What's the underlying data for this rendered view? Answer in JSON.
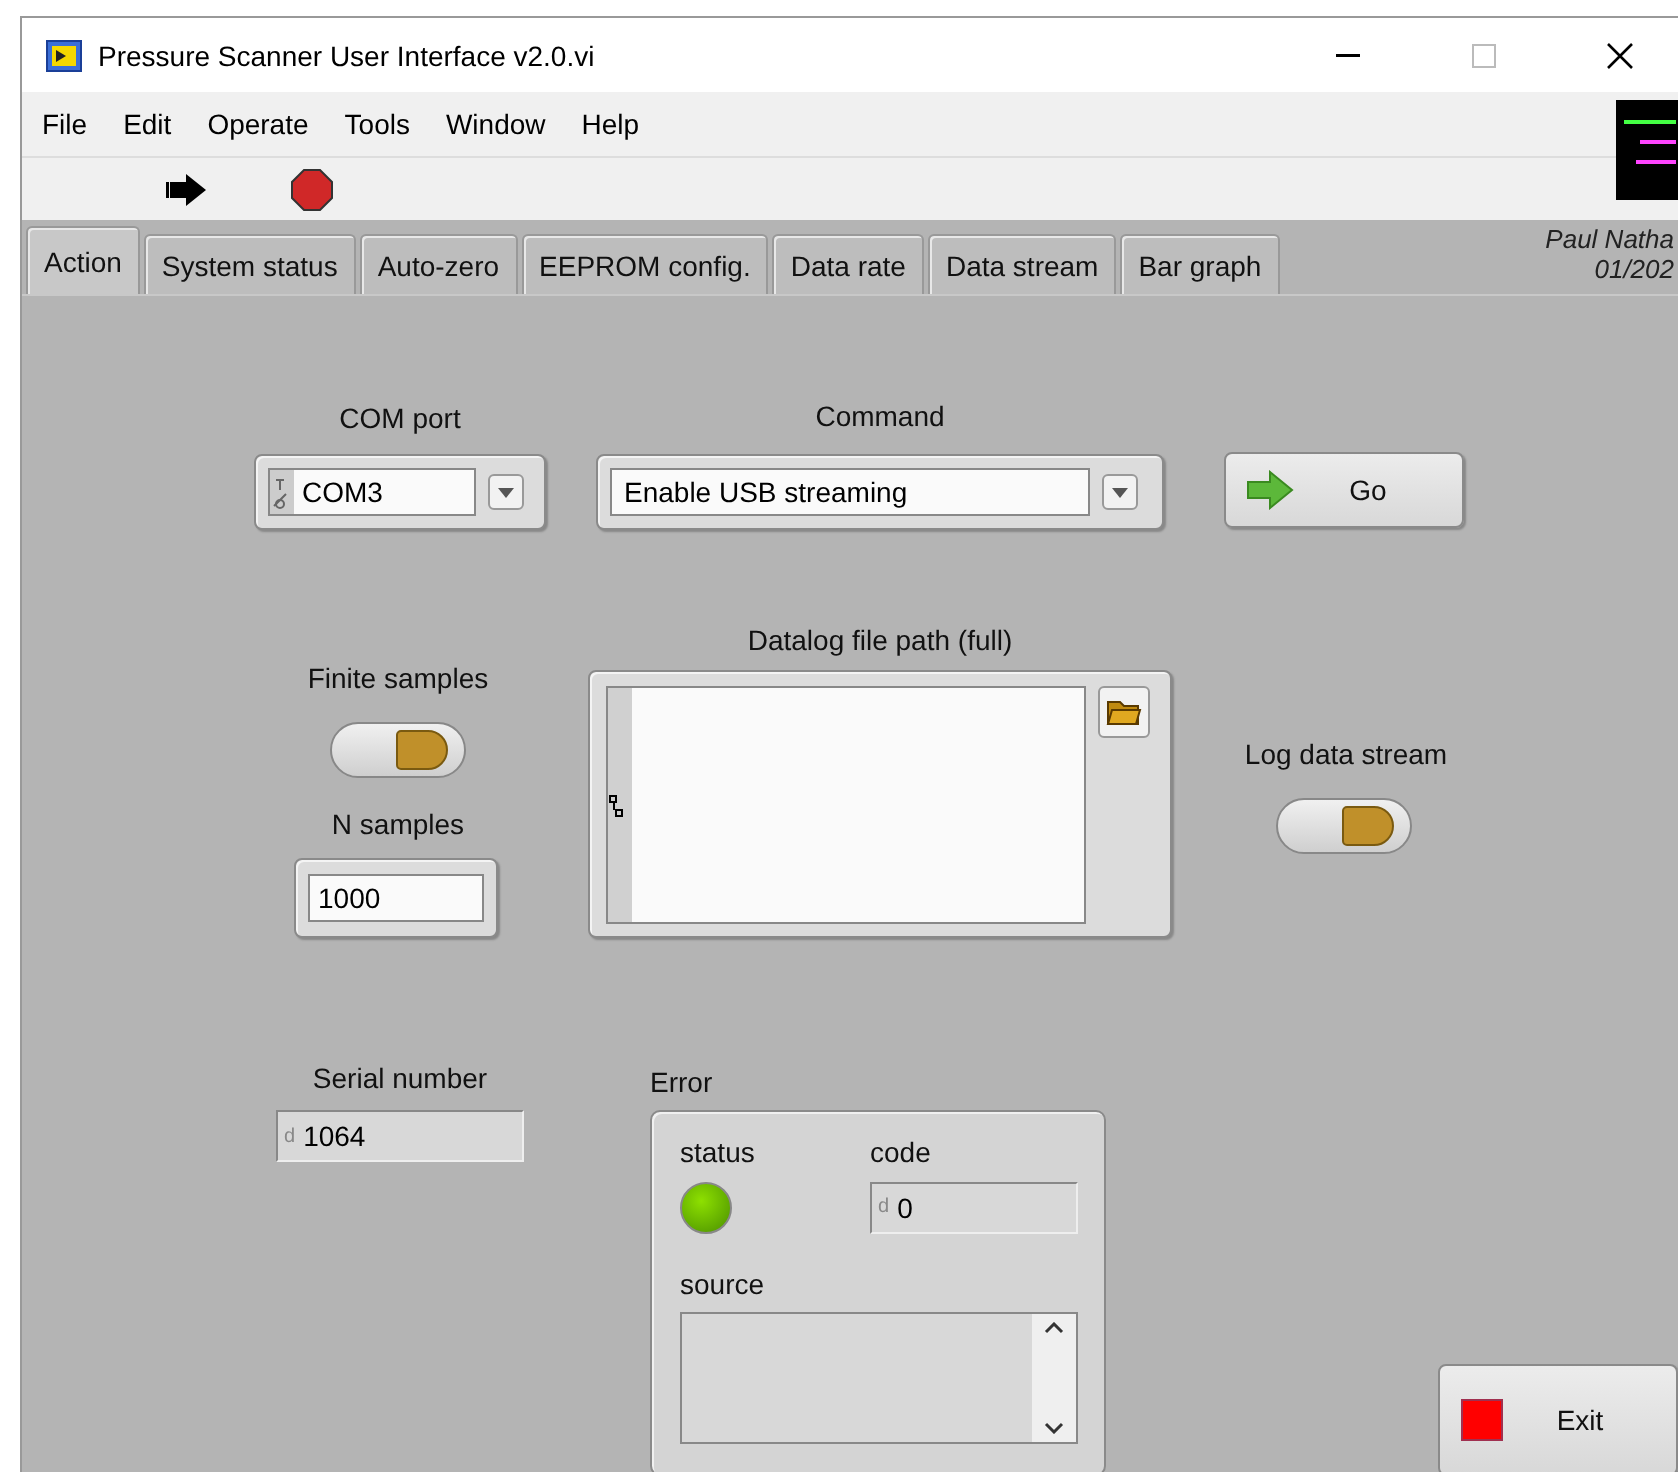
{
  "window": {
    "title": "Pressure Scanner User Interface v2.0.vi"
  },
  "menu": [
    "File",
    "Edit",
    "Operate",
    "Tools",
    "Window",
    "Help"
  ],
  "tabs": [
    {
      "label": "Action",
      "selected": true
    },
    {
      "label": "System status",
      "selected": false
    },
    {
      "label": "Auto-zero",
      "selected": false
    },
    {
      "label": "EEPROM config.",
      "selected": false
    },
    {
      "label": "Data rate",
      "selected": false
    },
    {
      "label": "Data stream",
      "selected": false
    },
    {
      "label": "Bar graph",
      "selected": false
    }
  ],
  "author": {
    "name": "Paul Natha",
    "date": "01/202"
  },
  "com_port": {
    "label": "COM port",
    "value": "COM3"
  },
  "command": {
    "label": "Command",
    "value": "Enable USB streaming"
  },
  "go_button": {
    "label": "Go"
  },
  "finite_samples": {
    "label": "Finite samples",
    "on": true
  },
  "n_samples": {
    "label": "N samples",
    "value": "1000"
  },
  "datalog_path": {
    "label": "Datalog file path (full)"
  },
  "log_data_stream": {
    "label": "Log data stream",
    "on": true
  },
  "serial_number": {
    "label": "Serial number",
    "radix": "d",
    "value": "1064"
  },
  "error": {
    "label": "Error",
    "status_label": "status",
    "status_error": false,
    "code_label": "code",
    "code_radix": "d",
    "code": "0",
    "source_label": "source"
  },
  "exit_button": {
    "label": "Exit"
  }
}
